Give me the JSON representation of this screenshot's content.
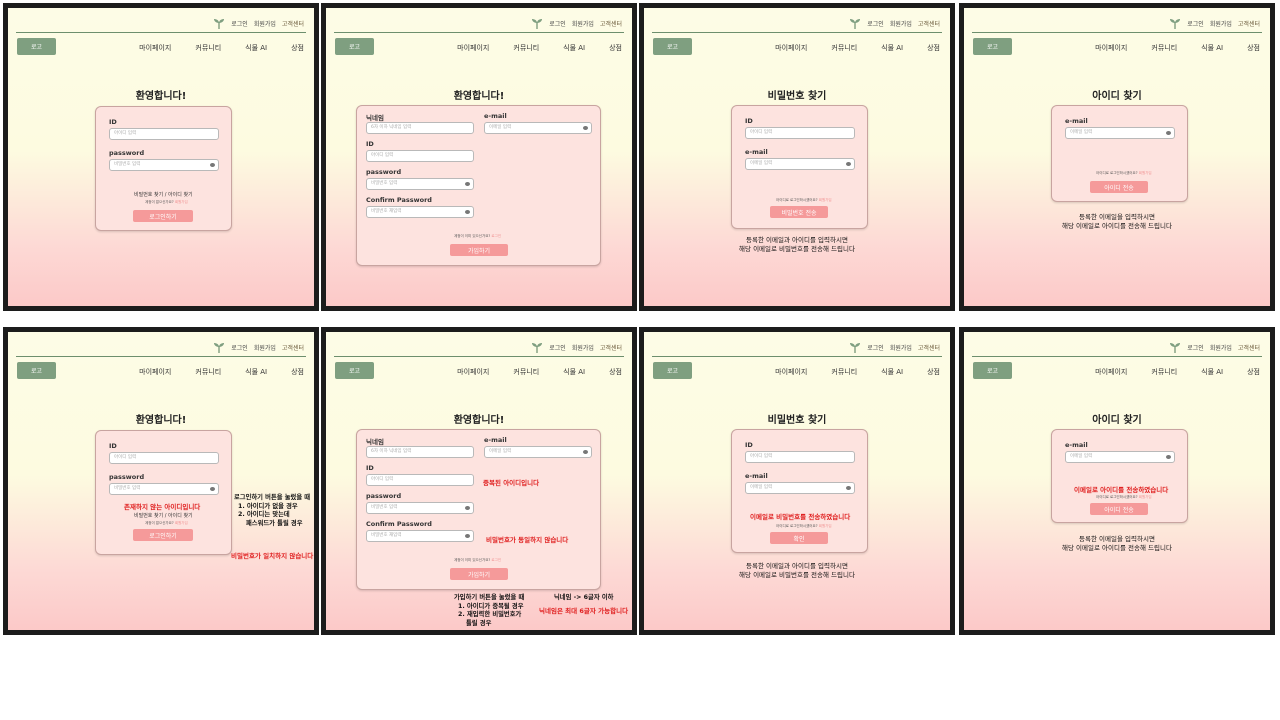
{
  "header": {
    "login": "로그인",
    "signup": "회원가입",
    "support": "고객센터",
    "logo": "로고",
    "nav": [
      "마이페이지",
      "커뮤니티",
      "식물 AI",
      "상점"
    ]
  },
  "login": {
    "title": "환영합니다!",
    "id_label": "ID",
    "id_placeholder": "아이디 입력",
    "pw_label": "password",
    "pw_placeholder": "비밀번호 입력",
    "find_links": "비밀번호 찾기  /  아이디 찾기",
    "signup_prompt": "계정이 없으신가요?",
    "signup_link": "회원가입",
    "login_button": "로그인하기",
    "error_no_id": "존재하지 않는 아이디입니다",
    "error_pw_mismatch": "비밀번호가 일치하지 않습니다",
    "annotation": [
      "로그인하기 버튼을 눌렀을 때",
      "1. 아이디가 없을 경우",
      "2. 아이디는 맞는데",
      "패스워드가 틀릴 경우"
    ]
  },
  "signup": {
    "title": "환영합니다!",
    "nickname_label": "닉네임",
    "nickname_placeholder": "6자 이하 닉네임 입력",
    "email_label": "e-mail",
    "email_placeholder": "이메일 입력",
    "id_label": "ID",
    "id_placeholder": "아이디 입력",
    "pw_label": "password",
    "pw_placeholder": "비밀번호 입력",
    "confirm_label": "Confirm Password",
    "confirm_placeholder": "비밀번호 재입력",
    "login_prompt": "계정이 이미 있으신가요?",
    "login_link": "로그인",
    "signup_button": "가입하기",
    "error_dup_id": "중복된 아이디입니다",
    "error_pw_mismatch": "비밀번호가 동일하지 않습니다",
    "annotation": [
      "가입하기 버튼을 눌렀을 때",
      "1. 아이디가 중복될 경우",
      "2. 재입력한 비밀번호가",
      "틀릴 경우"
    ],
    "nickname_rule": "닉네임 -> 6글자 이하",
    "nickname_error": "닉네임은 최대 6글자 가능합니다"
  },
  "find_pw": {
    "title": "비밀번호 찾기",
    "id_label": "ID",
    "id_placeholder": "아이디 입력",
    "email_label": "e-mail",
    "email_placeholder": "이메일 입력",
    "signup_prompt": "아이디로 로그인하시겠어요?",
    "signup_link": "회원가입",
    "send_button": "비밀번호 전송",
    "confirm_button": "확인",
    "sent_message": "이메일로 비밀번호를 전송하였습니다",
    "note": [
      "등록한 이메일과 아이디를 입력하시면",
      "해당 이메일로 비밀번호를 전송해 드립니다"
    ]
  },
  "find_id": {
    "title": "아이디 찾기",
    "email_label": "e-mail",
    "email_placeholder": "이메일 입력",
    "signup_prompt": "아이디로 로그인하시겠어요?",
    "signup_link": "회원가입",
    "send_button": "아이디 전송",
    "sent_message": "이메일로 아이디를 전송하였습니다",
    "note": [
      "등록한 이메일을 입력하시면",
      "해당 이메일로 아이디를 전송해 드립니다"
    ]
  },
  "colors": {
    "accent_green": "#7f9f80",
    "button_pink": "#f59a9a",
    "error_red": "#e02020",
    "card_pink": "#fde3df"
  },
  "icons": [
    "sprout-icon",
    "eye-icon"
  ]
}
